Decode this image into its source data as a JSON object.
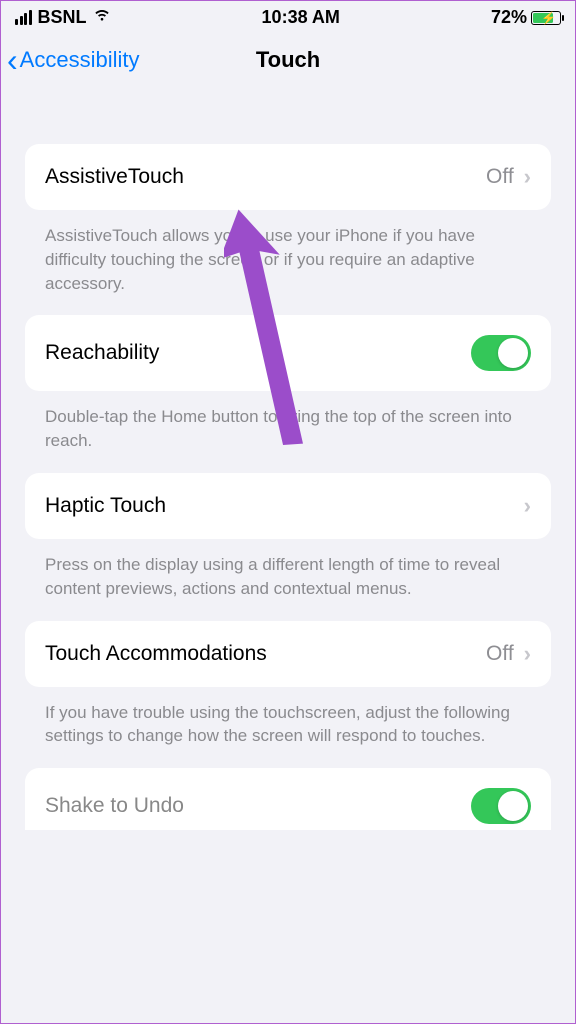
{
  "statusbar": {
    "carrier": "BSNL",
    "time": "10:38 AM",
    "battery_percent": "72%"
  },
  "nav": {
    "back_label": "Accessibility",
    "title": "Touch"
  },
  "rows": {
    "assistive": {
      "label": "AssistiveTouch",
      "value": "Off",
      "footer": "AssistiveTouch allows you to use your iPhone if you have difficulty touching the screen or if you require an adaptive accessory."
    },
    "reachability": {
      "label": "Reachability",
      "footer": "Double-tap the Home button to bring the top of the screen into reach."
    },
    "haptic": {
      "label": "Haptic Touch",
      "footer": "Press on the display using a different length of time to reveal content previews, actions and contextual menus."
    },
    "accommodations": {
      "label": "Touch Accommodations",
      "value": "Off",
      "footer": "If you have trouble using the touchscreen, adjust the following settings to change how the screen will respond to touches."
    },
    "shake": {
      "label": "Shake to Undo"
    }
  }
}
